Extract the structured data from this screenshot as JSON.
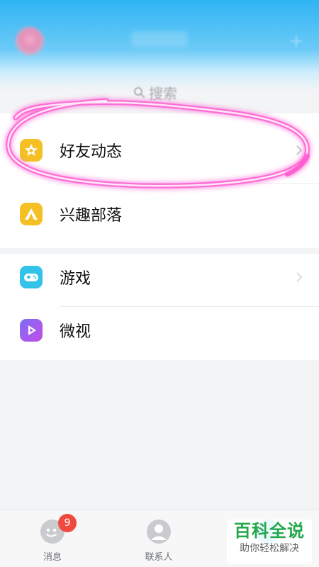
{
  "search": {
    "label": "搜索"
  },
  "menu": {
    "items": [
      {
        "label": "好友动态",
        "icon": "star-icon",
        "color": "#f5c024"
      },
      {
        "label": "兴趣部落",
        "icon": "tent-icon",
        "color": "#f5c024"
      },
      {
        "label": "游戏",
        "icon": "gamepad-icon",
        "color": "#31c3ea"
      },
      {
        "label": "微视",
        "icon": "play-icon",
        "color": "#a35bf0"
      }
    ]
  },
  "tabbar": {
    "tabs": [
      {
        "label": "消息",
        "badge": "9"
      },
      {
        "label": "联系人"
      }
    ]
  },
  "watermark": {
    "title": "百科全说",
    "subtitle": "助你轻松解决"
  },
  "colors": {
    "header": "#2fb4f4",
    "highlight": "#ff5fd2",
    "badge": "#f04a3e",
    "watermark": "#22a74a"
  }
}
